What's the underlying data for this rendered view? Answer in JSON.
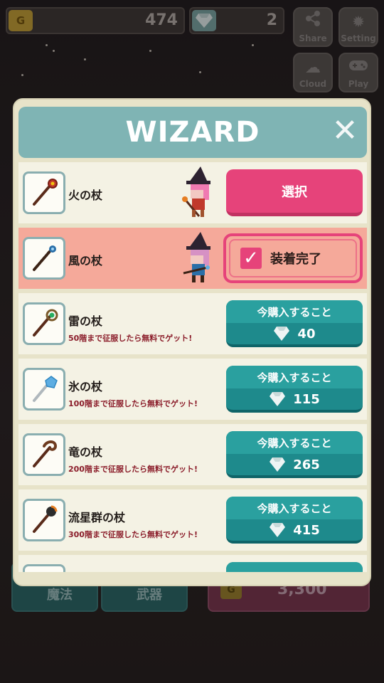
{
  "hud": {
    "coins": "474",
    "gems": "2",
    "coin_glyph": "G",
    "share_label": "Share",
    "setting_label": "Setting",
    "cloud_label": "Cloud",
    "play_label": "Play"
  },
  "background": {
    "tab_magic": "魔法",
    "tab_weapon": "武器",
    "price": "3,300"
  },
  "modal": {
    "title": "WIZARD",
    "close_icon": "close-icon"
  },
  "items": [
    {
      "name": "火の杖",
      "sub": "",
      "action": "select",
      "button_label": "選択",
      "staff_color": "#c0392b"
    },
    {
      "name": "風の杖",
      "sub": "",
      "action": "equipped",
      "button_label": "装着完了",
      "staff_color": "#2a6fa8"
    },
    {
      "name": "雷の杖",
      "sub": "50階まで征服したら無料でゲット!",
      "action": "buy",
      "buy_label": "今購入すること",
      "price": "40"
    },
    {
      "name": "氷の杖",
      "sub": "100階まで征服したら無料でゲット!",
      "action": "buy",
      "buy_label": "今購入すること",
      "price": "115"
    },
    {
      "name": "竜の杖",
      "sub": "200階まで征服したら無料でゲット!",
      "action": "buy",
      "buy_label": "今購入すること",
      "price": "265"
    },
    {
      "name": "流星群の杖",
      "sub": "300階まで征服したら無料でゲット!",
      "action": "buy",
      "buy_label": "今購入すること",
      "price": "415"
    }
  ],
  "colors": {
    "header": "#7fb4b4",
    "select_button": "#e6437a",
    "buy_button": "#2aa09f",
    "selected_row": "#f5a99a"
  }
}
